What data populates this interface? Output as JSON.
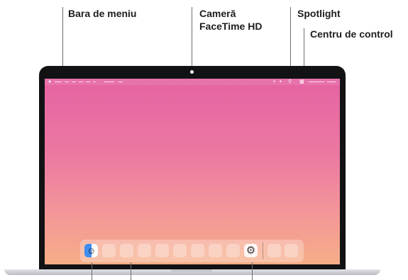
{
  "callouts": {
    "menu_bar": "Bara de meniu",
    "camera_line1": "Cameră",
    "camera_line2": "FaceTime HD",
    "spotlight": "Spotlight",
    "control_center": "Centru de control"
  },
  "dock": {
    "finder_icon": "finder-icon",
    "settings_icon": "system-settings-icon"
  },
  "colors": {
    "bezel": "#121214",
    "wallpaper_top": "#e563a3",
    "wallpaper_bottom": "#f6ae86"
  }
}
